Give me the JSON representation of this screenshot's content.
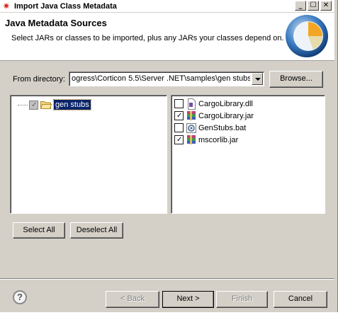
{
  "window": {
    "title": "Import Java Class Metadata",
    "controls": [
      "_",
      "☐",
      "✕"
    ]
  },
  "banner": {
    "heading": "Java Metadata Sources",
    "description": "Select JARs or classes to be imported, plus any JARs your classes depend on."
  },
  "from_directory": {
    "label": "From directory:",
    "value": "ogress\\Corticon 5.5\\Server .NET\\samples\\gen stubs",
    "browse_label": "Browse..."
  },
  "tree": {
    "items": [
      {
        "label": "gen stubs",
        "checked": "grayed",
        "selected": true
      }
    ]
  },
  "files": {
    "items": [
      {
        "label": "CargoLibrary.dll",
        "checked": false,
        "icon": "dll-file-icon"
      },
      {
        "label": "CargoLibrary.jar",
        "checked": true,
        "icon": "jar-archive-icon"
      },
      {
        "label": "GenStubs.bat",
        "checked": false,
        "icon": "batch-file-icon"
      },
      {
        "label": "mscorlib.jar",
        "checked": true,
        "icon": "jar-archive-icon"
      }
    ]
  },
  "selection_buttons": {
    "select_all": "Select All",
    "deselect_all": "Deselect All"
  },
  "footer": {
    "help": "?",
    "back": "< Back",
    "next": "Next >",
    "finish": "Finish",
    "cancel": "Cancel"
  },
  "colors": {
    "dialog_bg": "#d4d0c8",
    "selection_bg": "#0a246a",
    "title_icon": "#d9281a"
  }
}
